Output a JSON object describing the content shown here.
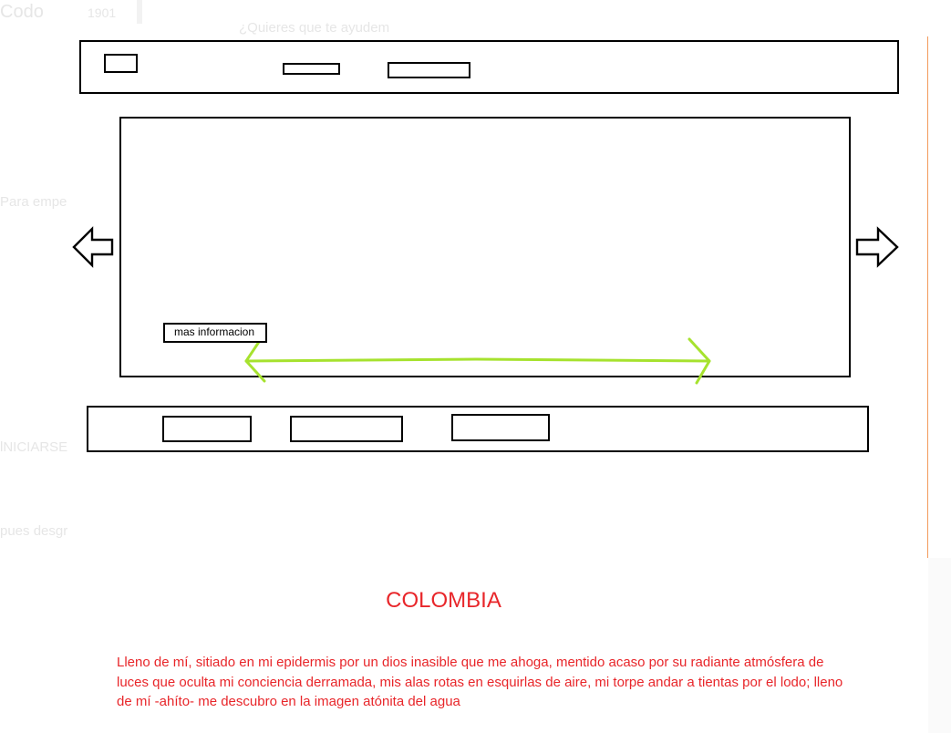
{
  "background_fragments": {
    "top_left": "Codo",
    "top_number": "1901",
    "top_question": "¿Quieres que te ayudemos?",
    "left_1": "Para empe",
    "left_2": "lNICIARSE",
    "left_3": "pues desgr"
  },
  "carousel": {
    "info_button_label": "mas informacion",
    "prev_icon": "arrow-left-outline-icon",
    "next_icon": "arrow-right-outline-icon",
    "swipe_icon": "double-headed-arrow-icon"
  },
  "colors": {
    "wireframe": "#000000",
    "swipe_indicator": "#a6e22e",
    "accent_text": "#e8262a",
    "divider": "#f39a5c"
  },
  "section": {
    "title": "COLOMBIA",
    "body": "Lleno de mí, sitiado en mi epidermis por un dios inasible que me ahoga, mentido acaso por su radiante atmósfera de luces que oculta mi conciencia derramada, mis alas rotas en esquirlas de aire, mi torpe andar a tientas por el lodo; lleno de mí -ahíto- me descubro en la imagen atónita del agua"
  }
}
